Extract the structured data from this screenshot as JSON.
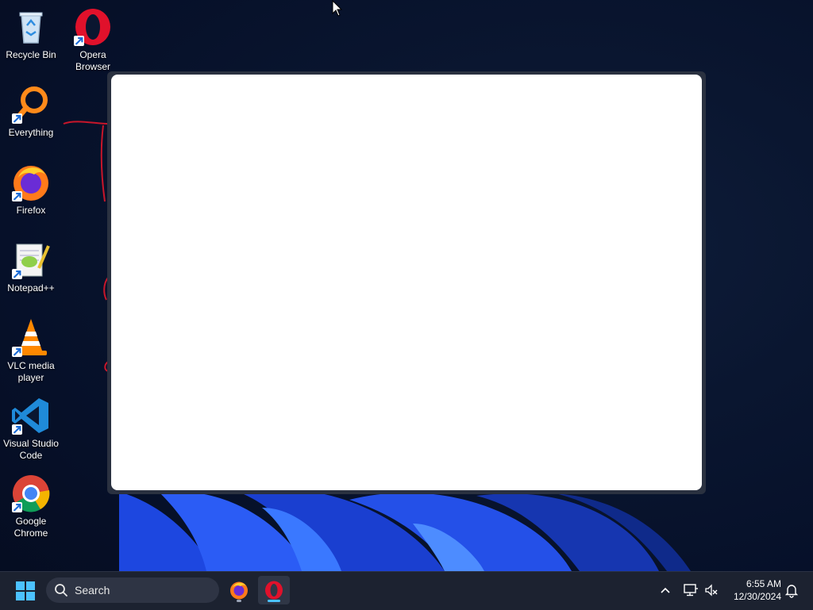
{
  "desktop": {
    "icons": [
      {
        "label": "Recycle Bin"
      },
      {
        "label": "Opera Browser"
      },
      {
        "label": "Everything"
      },
      {
        "label": "Firefox"
      },
      {
        "label": "Notepad++"
      },
      {
        "label": "VLC media player"
      },
      {
        "label": "Visual Studio Code"
      },
      {
        "label": "Google Chrome"
      }
    ]
  },
  "taskbar": {
    "search_placeholder": "Search",
    "time": "6:55 AM",
    "date": "12/30/2024"
  },
  "colors": {
    "accent": "#0078d4",
    "opera_red": "#e0112b",
    "taskbar_bg": "#1c2230"
  }
}
